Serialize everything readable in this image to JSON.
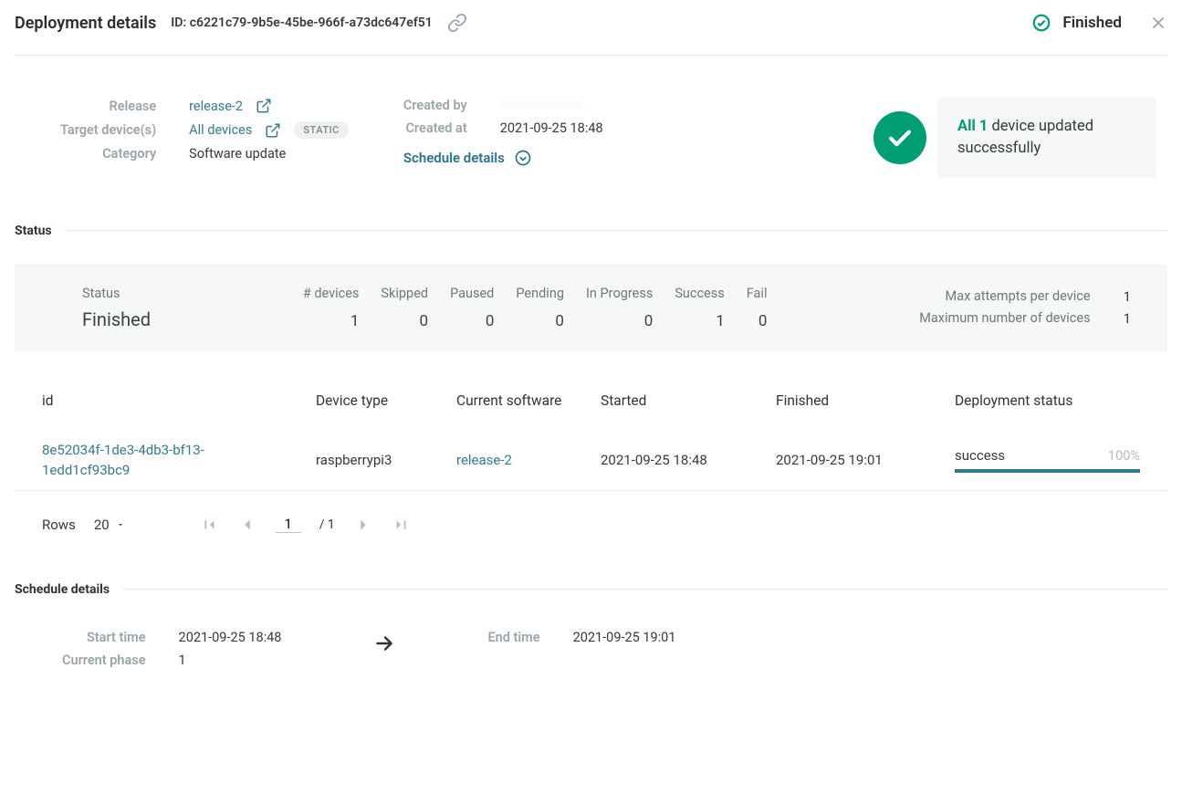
{
  "header": {
    "title": "Deployment details",
    "id_label": "ID: c6221c79-9b5e-45be-966f-a73dc647ef51",
    "status": "Finished"
  },
  "overview": {
    "release_label": "Release",
    "release_value": "release-2",
    "target_label": "Target device(s)",
    "target_value": "All devices",
    "static_badge": "STATIC",
    "category_label": "Category",
    "category_value": "Software update",
    "created_by_label": "Created by",
    "created_by_value": "————————",
    "created_at_label": "Created at",
    "created_at_value": "2021-09-25 18:48",
    "schedule_details_link": "Schedule details",
    "success_accent": "All 1",
    "success_tail": " device updated successfully"
  },
  "status_section": {
    "heading": "Status",
    "status_label": "Status",
    "status_value": "Finished",
    "counts": [
      {
        "label": "# devices",
        "value": "1"
      },
      {
        "label": "Skipped",
        "value": "0"
      },
      {
        "label": "Paused",
        "value": "0"
      },
      {
        "label": "Pending",
        "value": "0"
      },
      {
        "label": "In Progress",
        "value": "0"
      },
      {
        "label": "Success",
        "value": "1"
      },
      {
        "label": "Fail",
        "value": "0"
      }
    ],
    "max_attempts_label": "Max attempts per device",
    "max_attempts_value": "1",
    "max_devices_label": "Maximum number of devices",
    "max_devices_value": "1"
  },
  "table": {
    "headers": {
      "id": "id",
      "device_type": "Device type",
      "current_software": "Current software",
      "started": "Started",
      "finished": "Finished",
      "deployment_status": "Deployment status"
    },
    "row": {
      "id": "8e52034f-1de3-4db3-bf13-1edd1cf93bc9",
      "device_type": "raspberrypi3",
      "current_software": "release-2",
      "started": "2021-09-25 18:48",
      "finished": "2021-09-25 19:01",
      "status": "success",
      "pct": "100%"
    }
  },
  "pager": {
    "rows_label": "Rows",
    "rows_per_page": "20",
    "page_current": "1",
    "page_total": "/ 1"
  },
  "schedule": {
    "heading": "Schedule details",
    "start_label": "Start time",
    "start_value": "2021-09-25 18:48",
    "phase_label": "Current phase",
    "phase_value": "1",
    "end_label": "End time",
    "end_value": "2021-09-25 19:01"
  }
}
